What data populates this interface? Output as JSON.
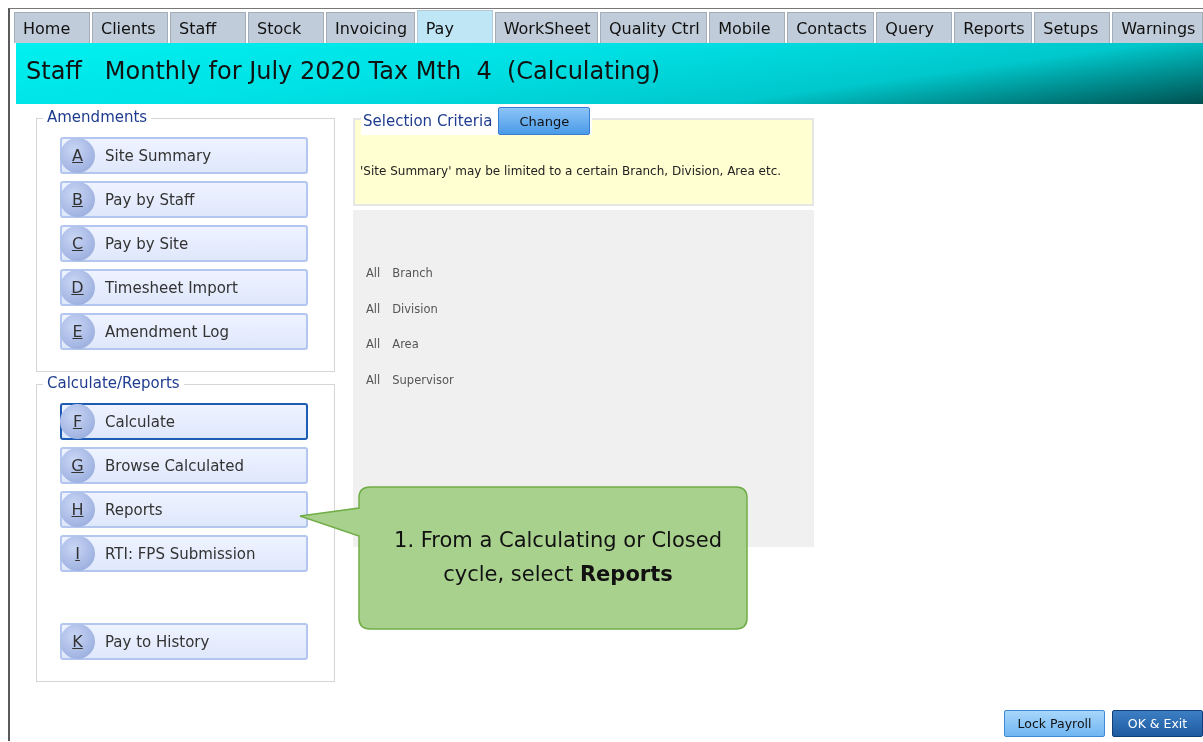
{
  "tabs": [
    {
      "label": "Home",
      "selected": false
    },
    {
      "label": "Clients",
      "selected": false
    },
    {
      "label": "Staff",
      "selected": false
    },
    {
      "label": "Stock",
      "selected": false
    },
    {
      "label": "Invoicing",
      "selected": false
    },
    {
      "label": "Pay",
      "selected": true
    },
    {
      "label": "WorkSheet",
      "selected": false
    },
    {
      "label": "Quality Ctrl",
      "selected": false
    },
    {
      "label": "Mobile",
      "selected": false
    },
    {
      "label": "Contacts",
      "selected": false
    },
    {
      "label": "Query",
      "selected": false
    },
    {
      "label": "Reports",
      "selected": false
    },
    {
      "label": "Setups",
      "selected": false
    },
    {
      "label": "Warnings",
      "selected": false
    }
  ],
  "header": {
    "title": "Staff   Monthly for July 2020 Tax Mth  4  (Calculating)"
  },
  "groups": [
    {
      "title": "Amendments",
      "buttons": [
        {
          "key": "A",
          "label": "Site Summary",
          "focused": false
        },
        {
          "key": "B",
          "label": "Pay by Staff",
          "focused": false
        },
        {
          "key": "C",
          "label": "Pay by Site",
          "focused": false
        },
        {
          "key": "D",
          "label": "Timesheet Import",
          "focused": false
        },
        {
          "key": "E",
          "label": "Amendment Log",
          "focused": false
        }
      ]
    },
    {
      "title": "Calculate/Reports",
      "buttons": [
        {
          "key": "F",
          "label": "Calculate",
          "focused": true
        },
        {
          "key": "G",
          "label": "Browse Calculated",
          "focused": false
        },
        {
          "key": "H",
          "label": "Reports",
          "focused": false
        },
        {
          "key": "I",
          "label": "RTI: FPS Submission",
          "focused": false
        },
        {
          "kind": "spacer"
        },
        {
          "key": "K",
          "label": "Pay to History",
          "focused": false
        }
      ]
    }
  ],
  "selection_criteria": {
    "title": "Selection Criteria",
    "change_button": "Change",
    "description": "'Site Summary' may be limited to a certain Branch, Division, Area etc.",
    "filters": [
      {
        "value": "All",
        "field": "Branch"
      },
      {
        "value": "All",
        "field": "Division"
      },
      {
        "value": "All",
        "field": "Area"
      },
      {
        "value": "All",
        "field": "Supervisor"
      }
    ]
  },
  "callout": {
    "text": "1. From a Calculating or Closed cycle, select **Reports**"
  },
  "footer_buttons": [
    {
      "label": "Lock Payroll",
      "kind": "normal"
    },
    {
      "label": "OK & Exit",
      "kind": "default"
    }
  ]
}
